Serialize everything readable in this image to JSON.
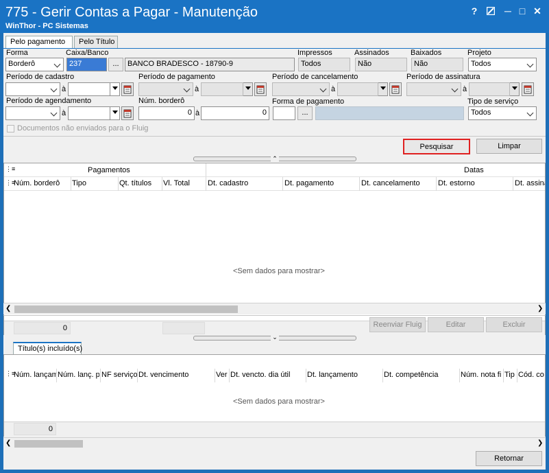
{
  "window": {
    "title": "775 - Gerir Contas a Pagar - Manutenção",
    "subtitle": "WinThor - PC Sistemas",
    "controls": [
      "?",
      "▪",
      "─",
      "□",
      "✕"
    ]
  },
  "tabs": [
    "Pelo pagamento",
    "Pelo Título"
  ],
  "filters": {
    "forma_label": "Forma",
    "forma_value": "Borderô",
    "caixa_label": "Caixa/Banco",
    "caixa_code": "237",
    "caixa_name": "BANCO BRADESCO - 18790-9",
    "impressos_label": "Impressos",
    "impressos_value": "Todos",
    "assinados_label": "Assinados",
    "assinados_value": "Não",
    "baixados_label": "Baixados",
    "baixados_value": "Não",
    "projeto_label": "Projeto",
    "projeto_value": "Todos",
    "periodo_cadastro_label": "Período de cadastro",
    "periodo_pagamento_label": "Período de pagamento",
    "periodo_cancelamento_label": "Período de cancelamento",
    "periodo_assinatura_label": "Período de assinatura",
    "a_label": "à",
    "periodo_agendamento_label": "Período de agendamento",
    "num_bordero_label": "Núm. borderô",
    "num_bordero_from": "0",
    "num_bordero_to": "0",
    "forma_pagamento_label": "Forma de pagamento",
    "tipo_servico_label": "Tipo de serviço",
    "tipo_servico_value": "Todos",
    "fluig_checkbox_label": "Documentos não enviados para o Fluig",
    "dots": "..."
  },
  "actions": {
    "pesquisar": "Pesquisar",
    "limpar": "Limpar",
    "reenviar": "Reenviar Fluig",
    "editar": "Editar",
    "excluir": "Excluir",
    "retornar": "Retornar"
  },
  "grid1": {
    "band_pagamentos": "Pagamentos",
    "band_datas": "Datas",
    "columns": [
      "Núm. borderô",
      "Tipo",
      "Qt. títulos",
      "Vl. Total",
      "Dt. cadastro",
      "Dt. pagamento",
      "Dt. cancelamento",
      "Dt. estorno",
      "Dt. assina"
    ],
    "empty": "<Sem dados para mostrar>",
    "footer_count": "0"
  },
  "subtab": "Título(s) incluído(s)",
  "grid2": {
    "columns": [
      "Núm. lançam",
      "Núm. lanç. p",
      "NF serviço",
      "Dt. vencimento",
      "Ver",
      "Dt. vencto. dia útil",
      "Dt. lançamento",
      "Dt. competência",
      "Núm. nota fi",
      "Tip",
      "Cód. co"
    ],
    "empty": "<Sem dados para mostrar>",
    "footer_count": "0"
  }
}
